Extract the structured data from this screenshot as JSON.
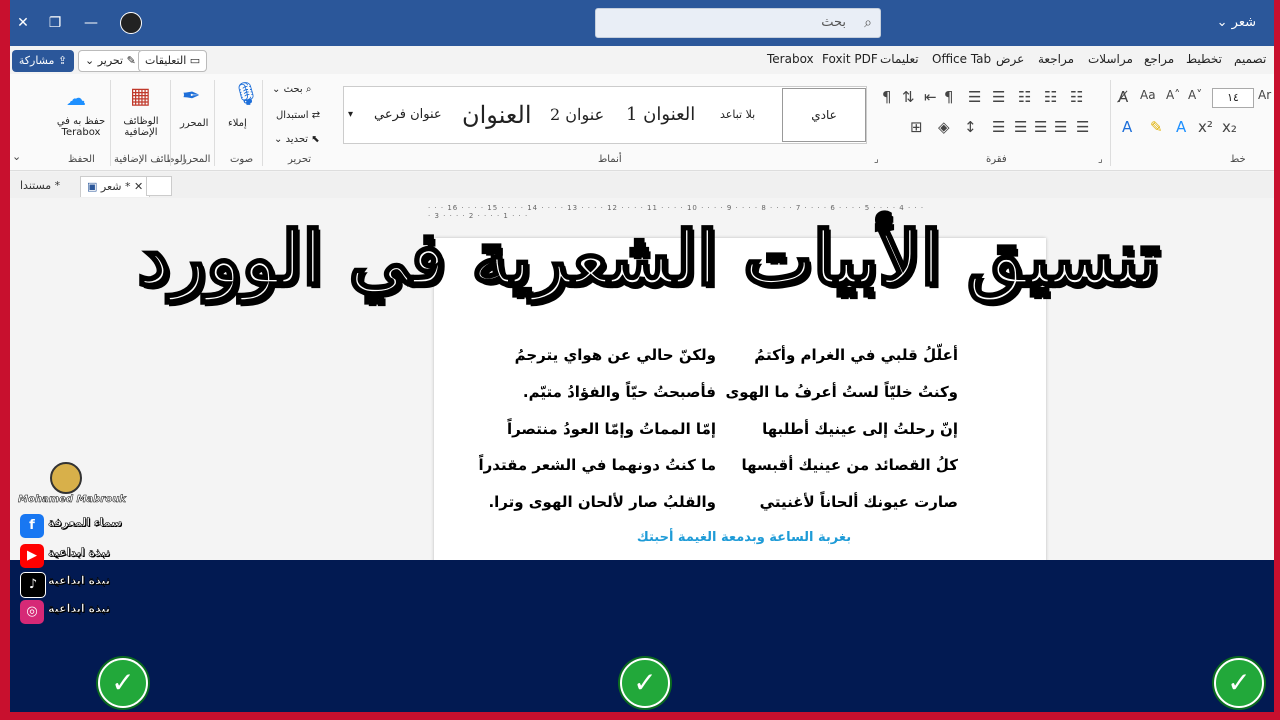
{
  "titlebar": {
    "doc_title": "شعر",
    "search_placeholder": "بحث",
    "close": "✕",
    "restore": "❐",
    "minimize": "—"
  },
  "menu": {
    "tabs": [
      "تصميم",
      "تخطيط",
      "مراجع",
      "مراسلات",
      "مراجعة",
      "عرض",
      "Office Tab",
      "تعليمات",
      "Foxit PDF",
      "Terabox"
    ],
    "comments": "التعليقات",
    "edit": "تحرير",
    "share": "مشاركة"
  },
  "ribbon": {
    "font_size": "١٤",
    "styles": [
      "عادي",
      "بلا تباعد",
      "العنوان 1",
      "عنوان 2",
      "العنوان",
      "عنوان فرعي"
    ],
    "editing": {
      "find": "بحث",
      "replace": "استبدال",
      "select": "تحديد"
    },
    "voice": {
      "dictate": "إملاء"
    },
    "editor": "المحرر",
    "addins": "الوظائف الإضافية",
    "save_terabox": "حفظ به في Terabox",
    "groups": {
      "font": "خط",
      "paragraph": "فقرة",
      "styles": "أنماط",
      "editing": "تحرير",
      "voice": "صوت",
      "editor": "المحرر",
      "addins": "الوظائف الإضافية",
      "save": "الحفظ"
    }
  },
  "doctabs": {
    "active": "شعر *",
    "other": "مستندا *"
  },
  "overlay_title": "تنسيق الأبيات الشعرية في الوورد",
  "poem": {
    "right": [
      "أعلّلُ قلبي في الغرام وأكتمُ",
      "وكنتُ خليّاً لستُ أعرفُ ما الهوى",
      "إنّ رحلتُ إلى عينيك أطلبها",
      "كلُ القصائد من عينيك أقبسها",
      "صارت عيونك ألحاناً لأغنيتي"
    ],
    "left": [
      "ولكنّ حالي عن هواي يترجمُ",
      "فأصبحتُ حيّاً والفؤادُ متيّم.",
      "إمّا المماتُ وإمّا العودُ منتصراً",
      "ما كنتُ دونهما في الشعر مقتدراً",
      "والقلبُ صار لألحان الهوى وترا."
    ],
    "footer": "بغربة الساعة وبدمعة الغيمة أحبتك"
  },
  "social": {
    "signature": "Mohamed Mabrouk",
    "items": [
      {
        "icon": "f",
        "label": "سماء المعرفة",
        "color": "#1877f2"
      },
      {
        "icon": "▶",
        "label": "نبذة ابداعية",
        "color": "#ff0000"
      },
      {
        "icon": "♪",
        "label": "نبذة ابداعية",
        "color": "#000000"
      },
      {
        "icon": "◎",
        "label": "نبذة ابداعية",
        "color": "#d62976"
      }
    ]
  },
  "colors": {
    "titlebar": "#2b579a",
    "band": "#021a52",
    "border": "#c8102e",
    "check": "#22a83a"
  }
}
